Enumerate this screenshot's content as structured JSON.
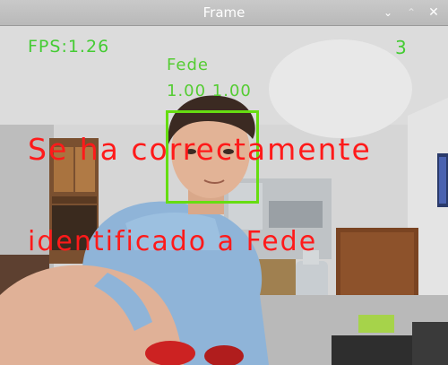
{
  "window": {
    "title": "Frame",
    "minimize_glyph": "⌄",
    "maximize_glyph": "⌃",
    "close_glyph": "✕"
  },
  "overlay": {
    "fps_label": "FPS:1.26",
    "count": "3",
    "recognized_name": "Fede",
    "recognition_scores": "1.00 1.00",
    "message_line1": "Se ha correctamente",
    "message_line2": "identificado a Fede"
  },
  "colors": {
    "overlay_green": "#44cc33",
    "message_red": "#ff1a1a",
    "face_box": "#66dd11"
  }
}
